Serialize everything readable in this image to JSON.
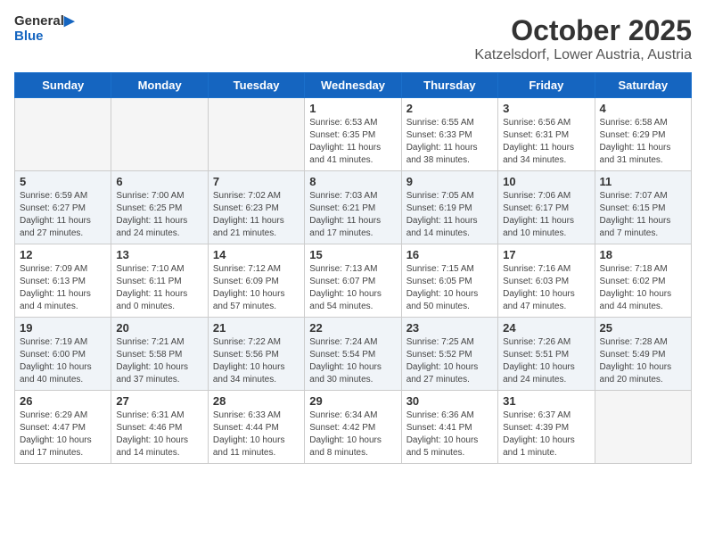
{
  "logo": {
    "line1": "General",
    "line2": "Blue"
  },
  "header": {
    "month": "October 2025",
    "location": "Katzelsdorf, Lower Austria, Austria"
  },
  "weekdays": [
    "Sunday",
    "Monday",
    "Tuesday",
    "Wednesday",
    "Thursday",
    "Friday",
    "Saturday"
  ],
  "weeks": [
    [
      {
        "day": "",
        "info": ""
      },
      {
        "day": "",
        "info": ""
      },
      {
        "day": "",
        "info": ""
      },
      {
        "day": "1",
        "info": "Sunrise: 6:53 AM\nSunset: 6:35 PM\nDaylight: 11 hours\nand 41 minutes."
      },
      {
        "day": "2",
        "info": "Sunrise: 6:55 AM\nSunset: 6:33 PM\nDaylight: 11 hours\nand 38 minutes."
      },
      {
        "day": "3",
        "info": "Sunrise: 6:56 AM\nSunset: 6:31 PM\nDaylight: 11 hours\nand 34 minutes."
      },
      {
        "day": "4",
        "info": "Sunrise: 6:58 AM\nSunset: 6:29 PM\nDaylight: 11 hours\nand 31 minutes."
      }
    ],
    [
      {
        "day": "5",
        "info": "Sunrise: 6:59 AM\nSunset: 6:27 PM\nDaylight: 11 hours\nand 27 minutes."
      },
      {
        "day": "6",
        "info": "Sunrise: 7:00 AM\nSunset: 6:25 PM\nDaylight: 11 hours\nand 24 minutes."
      },
      {
        "day": "7",
        "info": "Sunrise: 7:02 AM\nSunset: 6:23 PM\nDaylight: 11 hours\nand 21 minutes."
      },
      {
        "day": "8",
        "info": "Sunrise: 7:03 AM\nSunset: 6:21 PM\nDaylight: 11 hours\nand 17 minutes."
      },
      {
        "day": "9",
        "info": "Sunrise: 7:05 AM\nSunset: 6:19 PM\nDaylight: 11 hours\nand 14 minutes."
      },
      {
        "day": "10",
        "info": "Sunrise: 7:06 AM\nSunset: 6:17 PM\nDaylight: 11 hours\nand 10 minutes."
      },
      {
        "day": "11",
        "info": "Sunrise: 7:07 AM\nSunset: 6:15 PM\nDaylight: 11 hours\nand 7 minutes."
      }
    ],
    [
      {
        "day": "12",
        "info": "Sunrise: 7:09 AM\nSunset: 6:13 PM\nDaylight: 11 hours\nand 4 minutes."
      },
      {
        "day": "13",
        "info": "Sunrise: 7:10 AM\nSunset: 6:11 PM\nDaylight: 11 hours\nand 0 minutes."
      },
      {
        "day": "14",
        "info": "Sunrise: 7:12 AM\nSunset: 6:09 PM\nDaylight: 10 hours\nand 57 minutes."
      },
      {
        "day": "15",
        "info": "Sunrise: 7:13 AM\nSunset: 6:07 PM\nDaylight: 10 hours\nand 54 minutes."
      },
      {
        "day": "16",
        "info": "Sunrise: 7:15 AM\nSunset: 6:05 PM\nDaylight: 10 hours\nand 50 minutes."
      },
      {
        "day": "17",
        "info": "Sunrise: 7:16 AM\nSunset: 6:03 PM\nDaylight: 10 hours\nand 47 minutes."
      },
      {
        "day": "18",
        "info": "Sunrise: 7:18 AM\nSunset: 6:02 PM\nDaylight: 10 hours\nand 44 minutes."
      }
    ],
    [
      {
        "day": "19",
        "info": "Sunrise: 7:19 AM\nSunset: 6:00 PM\nDaylight: 10 hours\nand 40 minutes."
      },
      {
        "day": "20",
        "info": "Sunrise: 7:21 AM\nSunset: 5:58 PM\nDaylight: 10 hours\nand 37 minutes."
      },
      {
        "day": "21",
        "info": "Sunrise: 7:22 AM\nSunset: 5:56 PM\nDaylight: 10 hours\nand 34 minutes."
      },
      {
        "day": "22",
        "info": "Sunrise: 7:24 AM\nSunset: 5:54 PM\nDaylight: 10 hours\nand 30 minutes."
      },
      {
        "day": "23",
        "info": "Sunrise: 7:25 AM\nSunset: 5:52 PM\nDaylight: 10 hours\nand 27 minutes."
      },
      {
        "day": "24",
        "info": "Sunrise: 7:26 AM\nSunset: 5:51 PM\nDaylight: 10 hours\nand 24 minutes."
      },
      {
        "day": "25",
        "info": "Sunrise: 7:28 AM\nSunset: 5:49 PM\nDaylight: 10 hours\nand 20 minutes."
      }
    ],
    [
      {
        "day": "26",
        "info": "Sunrise: 6:29 AM\nSunset: 4:47 PM\nDaylight: 10 hours\nand 17 minutes."
      },
      {
        "day": "27",
        "info": "Sunrise: 6:31 AM\nSunset: 4:46 PM\nDaylight: 10 hours\nand 14 minutes."
      },
      {
        "day": "28",
        "info": "Sunrise: 6:33 AM\nSunset: 4:44 PM\nDaylight: 10 hours\nand 11 minutes."
      },
      {
        "day": "29",
        "info": "Sunrise: 6:34 AM\nSunset: 4:42 PM\nDaylight: 10 hours\nand 8 minutes."
      },
      {
        "day": "30",
        "info": "Sunrise: 6:36 AM\nSunset: 4:41 PM\nDaylight: 10 hours\nand 5 minutes."
      },
      {
        "day": "31",
        "info": "Sunrise: 6:37 AM\nSunset: 4:39 PM\nDaylight: 10 hours\nand 1 minute."
      },
      {
        "day": "",
        "info": ""
      }
    ]
  ]
}
